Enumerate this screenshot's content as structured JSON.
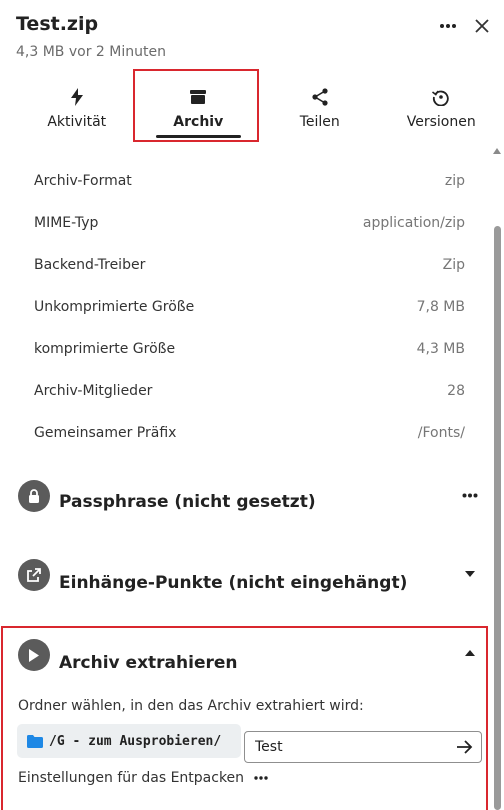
{
  "header": {
    "title": "Test.zip",
    "subtitle": "4,3 MB vor 2 Minuten",
    "more_icon": "more-horizontal-icon",
    "close_icon": "close-icon"
  },
  "tabs": [
    {
      "label": "Aktivität",
      "icon": "flash-icon",
      "active": false
    },
    {
      "label": "Archiv",
      "icon": "archive-icon",
      "active": true
    },
    {
      "label": "Teilen",
      "icon": "share-icon",
      "active": false
    },
    {
      "label": "Versionen",
      "icon": "history-icon",
      "active": false
    }
  ],
  "properties": [
    {
      "key": "Archiv-Format",
      "value": "zip"
    },
    {
      "key": "MIME-Typ",
      "value": "application/zip"
    },
    {
      "key": "Backend-Treiber",
      "value": "Zip"
    },
    {
      "key": "Unkomprimierte Größe",
      "value": "7,8 MB"
    },
    {
      "key": "komprimierte Größe",
      "value": "4,3 MB"
    },
    {
      "key": "Archiv-Mitglieder",
      "value": "28"
    },
    {
      "key": "Gemeinsamer Präfix",
      "value": "/Fonts/"
    }
  ],
  "sections": {
    "passphrase": {
      "title": "Passphrase (nicht gesetzt)",
      "icon": "lock-icon",
      "action_icon": "more-horizontal-icon"
    },
    "mounts": {
      "title": "Einhänge-Punkte (nicht eingehängt)",
      "icon": "open-external-icon",
      "action_icon": "caret-down-icon"
    },
    "extract": {
      "title": "Archiv extrahieren",
      "icon": "play-icon",
      "action_icon": "caret-up-icon",
      "hint": "Ordner wählen, in den das Archiv extrahiert wird:",
      "folder_path": "/G - zum Ausprobieren/",
      "name_value": "Test",
      "submit_icon": "arrow-right-icon",
      "settings_label": "Einstellungen für das Entpacken"
    }
  },
  "colors": {
    "highlight": "#d9272e",
    "folder_icon": "#1e88e5",
    "section_icon_bg": "#5b5b5b"
  }
}
